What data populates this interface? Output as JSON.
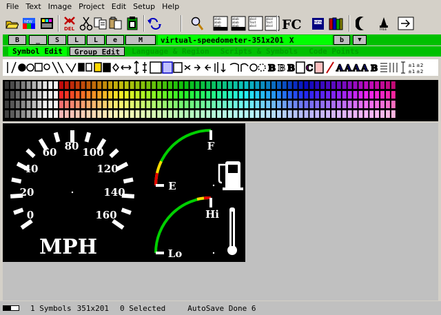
{
  "menu": [
    "File",
    "Text",
    "Image",
    "Project",
    "Edit",
    "Setup",
    "Help"
  ],
  "toolbar": {
    "tools": [
      {
        "name": "open-icon"
      },
      {
        "name": "color-mode-icon"
      },
      {
        "name": "new-file-icon"
      },
      {
        "name": "delete-icon",
        "label": "DEL"
      },
      {
        "name": "cut-icon"
      },
      {
        "name": "copy-icon"
      },
      {
        "name": "paste-icon"
      },
      {
        "name": "clipboard-icon"
      },
      {
        "name": "undo-icon"
      },
      {
        "name": "zoom-icon"
      },
      {
        "name": "symbol-grid-icon"
      },
      {
        "name": "symbol-list-icon"
      },
      {
        "name": "text-grid-icon"
      },
      {
        "name": "text-font-icon"
      },
      {
        "name": "font-compile-icon",
        "label": "FC"
      },
      {
        "name": "new-book-icon"
      },
      {
        "name": "books-icon"
      },
      {
        "name": "moon-icon"
      },
      {
        "name": "bell-icon"
      },
      {
        "name": "exit-icon"
      }
    ]
  },
  "tabs": {
    "letters": [
      "B",
      "_",
      "S",
      "L",
      "L",
      "e",
      "M"
    ],
    "file_tab": "virtual-speedometer-351x201",
    "close": "X",
    "after": "b",
    "dropdown": "▼"
  },
  "modes": [
    "Symbol Edit",
    "Group Edit",
    "Language & Region",
    "Scripts & Symbols",
    "Code Points"
  ],
  "gauge": {
    "speed_ticks": [
      "0",
      "20",
      "40",
      "60",
      "80",
      "100",
      "120",
      "140",
      "160"
    ],
    "unit": "MPH",
    "fuel_full": "F",
    "fuel_empty": "E",
    "temp_high": "Hi",
    "temp_low": "Lo"
  },
  "status": {
    "symbols": "1 Symbols",
    "size": "351x201",
    "selected": "0 Selected",
    "autosave": "AutoSave Done 6"
  },
  "colors": {
    "tab_green": "#00c000",
    "active_green": "#00ff00",
    "gauge_green": "#00d000",
    "gauge_yellow": "#ffd800",
    "gauge_red": "#e00000"
  }
}
